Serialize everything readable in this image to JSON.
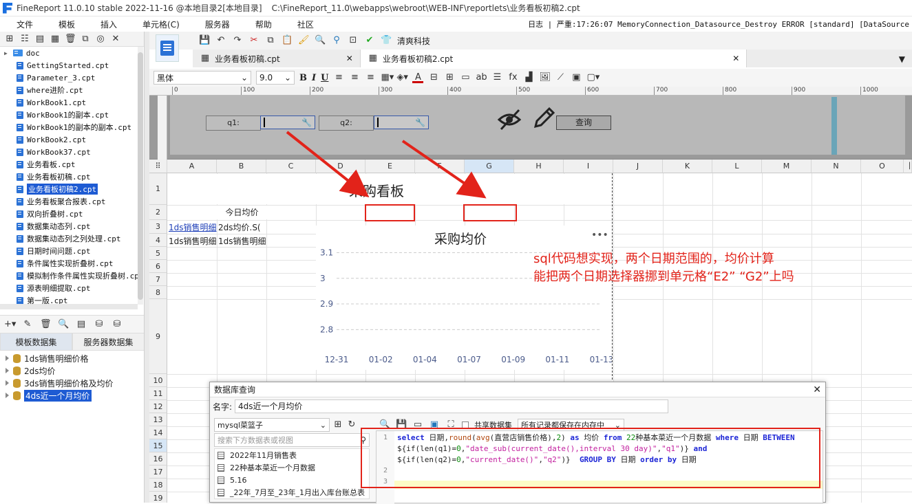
{
  "window": {
    "title": "FineReport 11.0.10 stable 2022-11-16 @本地目录2[本地目录]",
    "path": "C:\\FineReport_11.0\\webapps\\webroot\\WEB-INF\\reportlets\\业务看板初稿2.cpt"
  },
  "menu": [
    "文件",
    "模板",
    "插入",
    "单元格(C)",
    "服务器",
    "帮助",
    "社区"
  ],
  "log": "日志 | 严重:17:26:07 MemoryConnection_Datasource_Destroy ERROR [standard] [DataSource",
  "filetree": [
    {
      "label": "doc",
      "type": "folder"
    },
    {
      "label": "GettingStarted.cpt"
    },
    {
      "label": "Parameter_3.cpt"
    },
    {
      "label": "where进阶.cpt"
    },
    {
      "label": "WorkBook1.cpt"
    },
    {
      "label": "WorkBook1的副本.cpt"
    },
    {
      "label": "WorkBook1的副本的副本.cpt"
    },
    {
      "label": "WorkBook2.cpt"
    },
    {
      "label": "WorkBook37.cpt"
    },
    {
      "label": "业务看板.cpt"
    },
    {
      "label": "业务看板初稿.cpt"
    },
    {
      "label": "业务看板初稿2.cpt",
      "selected": true
    },
    {
      "label": "业务看板聚合报表.cpt"
    },
    {
      "label": "双向折叠树.cpt"
    },
    {
      "label": "数据集动态列.cpt"
    },
    {
      "label": "数据集动态列之列处理.cpt"
    },
    {
      "label": "日期时间问题.cpt"
    },
    {
      "label": "条件属性实现折叠树.cpt"
    },
    {
      "label": "模拟制作条件属性实现折叠树.cpt"
    },
    {
      "label": "源表明细提取.cpt"
    },
    {
      "label": "第一版.cpt"
    }
  ],
  "ds_tabs": [
    "模板数据集",
    "服务器数据集"
  ],
  "datasets": [
    "1ds销售明细价格",
    "2ds均价",
    "3ds销售明细价格及均价",
    "4ds近一个月均价"
  ],
  "doc_tabs": [
    "业务看板初稿.cpt",
    "业务看板初稿2.cpt"
  ],
  "toolbar": {
    "brand": "清爽科技",
    "font": "黑体",
    "size": "9.0"
  },
  "ruler": [
    "0",
    "100",
    "200",
    "300",
    "400",
    "500",
    "600",
    "700",
    "800",
    "900",
    "1000"
  ],
  "params": {
    "q1_label": "q1:",
    "q2_label": "q2:",
    "query_button": "查询"
  },
  "columns": [
    "A",
    "B",
    "C",
    "D",
    "E",
    "F",
    "G",
    "H",
    "I",
    "J",
    "K",
    "L",
    "M",
    "N",
    "O"
  ],
  "rows": [
    "1",
    "2",
    "3",
    "4",
    "5",
    "6",
    "7",
    "8",
    "9",
    "10",
    "11",
    "12",
    "13",
    "14",
    "15",
    "16",
    "17",
    "18",
    "19"
  ],
  "cells": {
    "title": "采购看板",
    "today_avg": "今日均价",
    "a3": "1ds销售明细",
    "b3": "2ds均价.S(",
    "a4": "1ds销售明细",
    "b4": "1ds销售明细"
  },
  "chart_data": {
    "type": "line",
    "title": "采购均价",
    "categories": [
      "12-31",
      "01-02",
      "01-04",
      "01-07",
      "01-09",
      "01-11",
      "01-13"
    ],
    "yticks": [
      "3.1",
      "3",
      "2.9",
      "2.8"
    ],
    "ylim": [
      2.75,
      3.12
    ],
    "series": []
  },
  "annotation": {
    "line1": "sql代码想实现，两个日期范围的，均价计算",
    "line2": "能把两个日期选择器挪到单元格“E2” “G2”上吗"
  },
  "dialog": {
    "title": "数据库查询",
    "name_label": "名字:",
    "name_value": "4ds近一个月均价",
    "connection": "mysql菜篮子",
    "search_placeholder": "搜索下方数据表或视图",
    "share_label": "共享数据集",
    "memory_option": "所有记录都保存在内存中",
    "tables": [
      "2022年11月销售表",
      "22种基本菜近一个月数据",
      "5.16",
      "_22年_7月至_23年_1月出入库台账总表"
    ]
  },
  "sql": {
    "line_numbers": [
      "1",
      "",
      "",
      "2",
      "3"
    ]
  }
}
